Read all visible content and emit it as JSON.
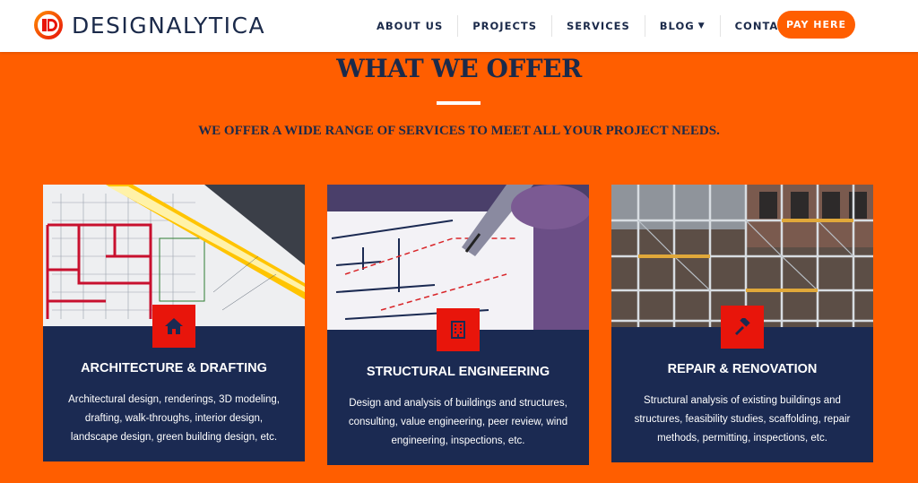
{
  "brand": {
    "name": "DESIGNALYTICA",
    "accent": "#ff5e00",
    "navy": "#1b2a52",
    "icon_red": "#e8150b"
  },
  "nav": {
    "items": [
      {
        "label": "ABOUT US"
      },
      {
        "label": "PROJECTS"
      },
      {
        "label": "SERVICES"
      },
      {
        "label": "BLOG",
        "has_dropdown": true
      },
      {
        "label": "CONTACT"
      }
    ],
    "cta_label": "PAY HERE"
  },
  "section": {
    "title": "WHAT WE OFFER",
    "subtitle": "WE OFFER A WIDE RANGE OF SERVICES TO MEET ALL YOUR PROJECT NEEDS."
  },
  "cards": [
    {
      "icon": "home-icon",
      "title": "ARCHITECTURE & DRAFTING",
      "desc_lines": [
        "Architectural design, renderings, 3D modeling,",
        "drafting, walk-throughs, interior design,",
        "landscape design, green building design, etc."
      ]
    },
    {
      "icon": "building-icon",
      "title": "STRUCTURAL ENGINEERING",
      "desc_lines": [
        "Design and analysis of buildings and structures,",
        "consulting, value engineering, peer review, wind",
        "engineering, inspections, etc."
      ]
    },
    {
      "icon": "hammer-icon",
      "title": "REPAIR & RENOVATION",
      "desc_lines": [
        "Structural analysis of existing buildings and",
        "structures, feasibility studies, scaffolding, repair",
        "methods, permitting, inspections, etc."
      ]
    }
  ]
}
